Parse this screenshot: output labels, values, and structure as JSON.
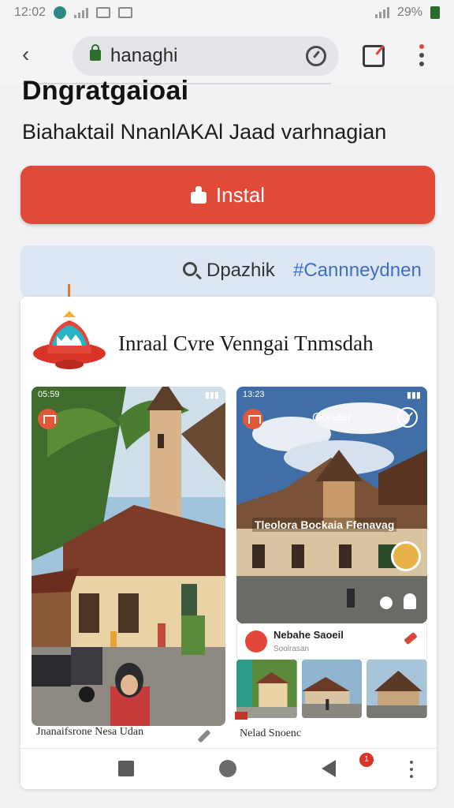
{
  "status_bar": {
    "time": "12:02",
    "battery": "29%"
  },
  "browser": {
    "url": "hanaghi",
    "back_label": "‹",
    "icons": [
      "lock-icon",
      "speedometer-icon",
      "tab-icon",
      "menu-icon"
    ]
  },
  "page": {
    "title": "Dngratgaioai",
    "subtitle": "Biahaktail NnanlAKAl Jaad varhnagian",
    "install_label": "Instal",
    "search_label": "Dpazhik",
    "hashtag": "#Cannneydnen"
  },
  "card": {
    "app_name": "Inraal Cvre Venngai Tnmsdah",
    "left_shot": {
      "status_time": "05:59",
      "caption": "Jnanaifsrone Nesa Udan"
    },
    "right_shot": {
      "status_time": "13:23",
      "title": "Gonaet",
      "overlay": "Tleolora Bockaia Ffenavag"
    },
    "mini_card": {
      "title": "Nebahe Saoeil",
      "subtitle": "Soolrasan"
    },
    "caption_right": "Nelad Snoenc"
  },
  "nav": {
    "badge": "1"
  },
  "colors": {
    "accent": "#e04a38",
    "link": "#3e6fc6",
    "strip": "#dde7f4"
  }
}
